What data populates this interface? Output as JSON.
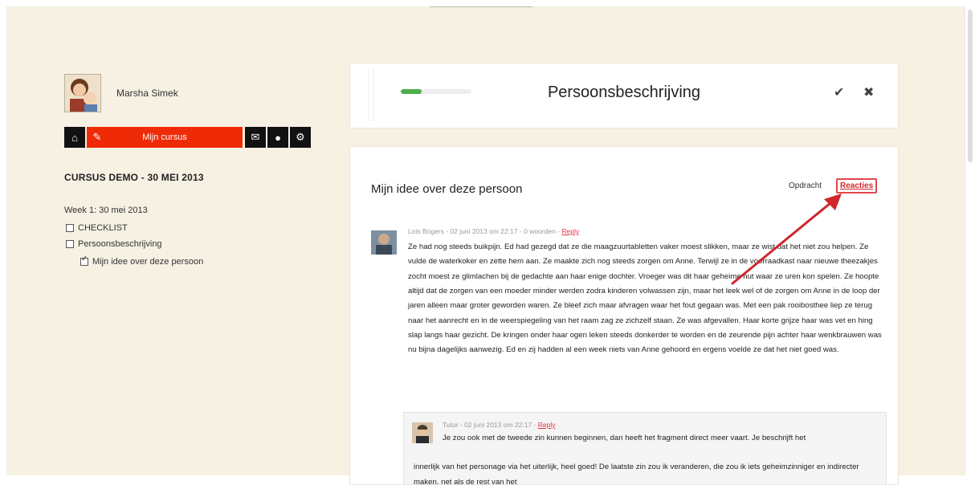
{
  "sidebar": {
    "user_name": "Marsha Simek",
    "nav": {
      "home_icon": "home-icon",
      "course_icon": "edit-icon",
      "course_label": "Mijn cursus",
      "mail_icon": "mail-icon",
      "user_icon": "user-icon",
      "settings_icon": "gear-icon"
    },
    "course_title": "CURSUS DEMO - 30 MEI 2013",
    "week_title": "Week 1: 30 mei 2013",
    "items": [
      {
        "label": "CHECKLIST",
        "checked": false
      },
      {
        "label": "Persoonsbeschrijving",
        "checked": false
      },
      {
        "label": "Mijn idee over deze persoon",
        "checked": true
      }
    ]
  },
  "header": {
    "title": "Persoonsbeschrijving",
    "progress_fraction": 0.3,
    "confirm_icon": "check-icon",
    "close_icon": "close-icon",
    "accent_color": "#4cae4c"
  },
  "content": {
    "title": "Mijn idee over deze persoon",
    "tabs": {
      "opdracht": "Opdracht",
      "reacties": "Reacties"
    },
    "comment": {
      "meta": "Lois Bogers - 02 juni 2013 om 22:17 - 0 woorden - ",
      "reply_label": "Reply",
      "body": "Ze had nog steeds buikpijn. Ed had gezegd dat ze die maagzuurtabletten vaker moest slikken, maar ze wist dat het niet zou helpen. Ze vulde de waterkoker en zette hem aan. Ze maakte zich nog steeds zorgen om Anne. Terwijl ze in de voorraadkast naar nieuwe theezakjes zocht moest ze glimlachen bij de gedachte aan haar enige dochter. Vroeger was dit haar geheime hut waar ze uren kon spelen. Ze hoopte altijd dat de zorgen van een moeder minder werden zodra kinderen volwassen zijn, maar het leek wel of de zorgen om Anne in de loop der jaren alleen maar groter geworden waren. Ze bleef zich maar afvragen waar het fout gegaan was. Met een pak rooibosthee liep ze terug naar het aanrecht en in de weerspiegeling van het raam zag ze zichzelf staan. Ze was afgevallen. Haar korte grijze haar was vet en hing slap langs haar gezicht. De kringen onder haar ogen leken steeds donkerder te worden en de zeurende pijn achter haar wenkbrauwen was nu bijna dagelijks aanwezig. Ed en zij hadden al een week niets van Anne gehoord en ergens voelde ze dat het niet goed was."
    },
    "reply": {
      "meta": "Tutor - 02 juni 2013 om 22:17 - ",
      "reply_label": "Reply",
      "body_line1": "Je zou ook met de tweede zin kunnen beginnen, dan heeft het fragment direct meer vaart. Je beschrijft het",
      "body_rest": "innerlijk van het personage via het uiterlijk, heel goed! De laatste zin zou ik veranderen, die zou ik iets geheimzinniger en indirecter maken, net als de rest van het"
    }
  },
  "annotation": {
    "arrow_color": "#d0262e"
  }
}
